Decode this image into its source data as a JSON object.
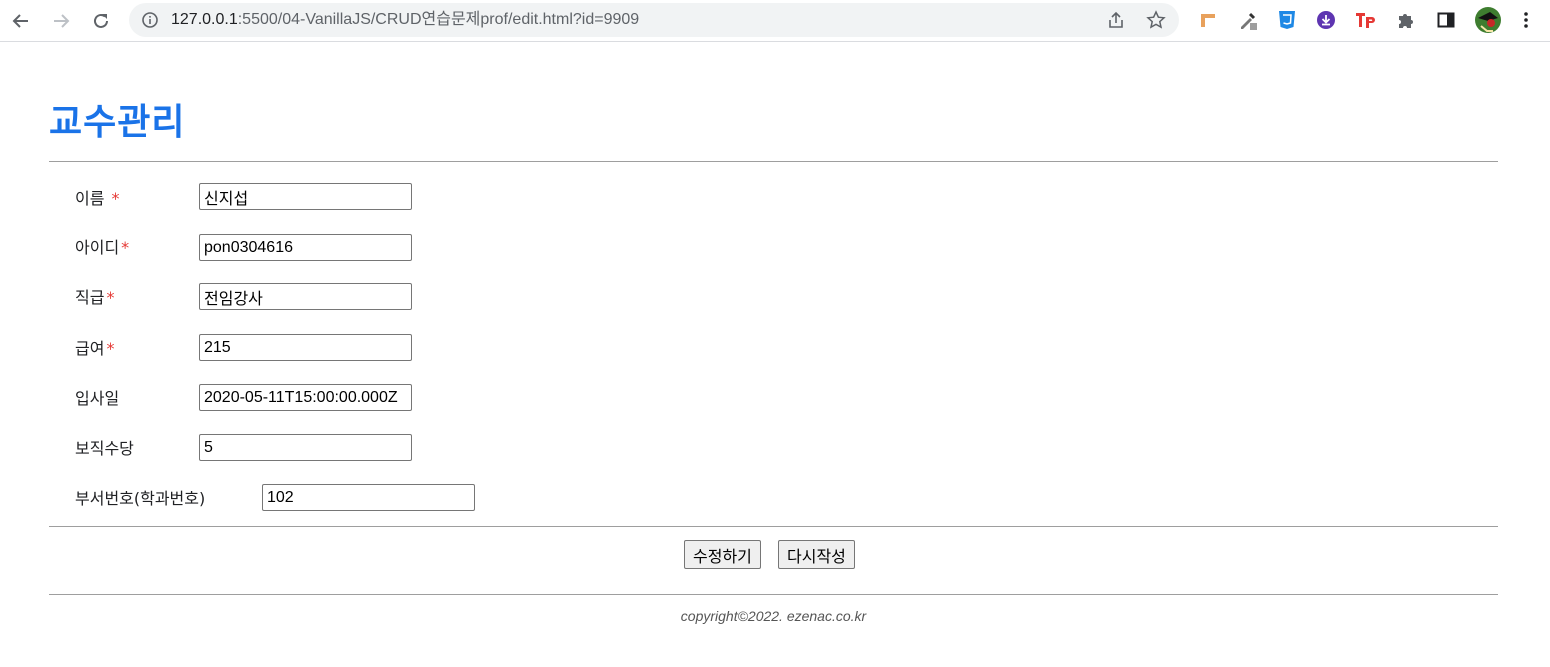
{
  "browser": {
    "url_host": "127.0.0.1",
    "url_rest": ":5500/04-VanillaJS/CRUD연습문제prof/edit.html?id=9909"
  },
  "page": {
    "title": "교수관리"
  },
  "form": {
    "name": {
      "label": "이름",
      "required_mark": "*",
      "value": "신지섭"
    },
    "userid": {
      "label": "아이디",
      "required_mark": "*",
      "value": "pon0304616"
    },
    "position": {
      "label": "직급",
      "required_mark": "*",
      "value": "전임강사"
    },
    "salary": {
      "label": "급여",
      "required_mark": "*",
      "value": "215"
    },
    "hiredate": {
      "label": "입사일",
      "value": "2020-05-11T15:00:00.000Z"
    },
    "comm": {
      "label": "보직수당",
      "value": "5"
    },
    "deptno": {
      "label": "부서번호(학과번호)",
      "value": "102"
    }
  },
  "buttons": {
    "submit": "수정하기",
    "reset": "다시작성"
  },
  "footer": {
    "text": "copyright©2022. ezenac.co.kr"
  }
}
